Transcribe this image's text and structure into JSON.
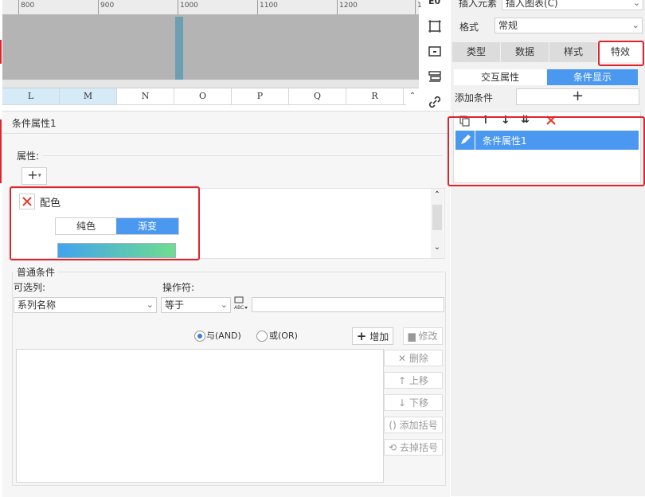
{
  "ruler": {
    "ticks": [
      "800",
      "900",
      "1000",
      "1100",
      "1200",
      "1"
    ]
  },
  "columns": [
    "L",
    "M",
    "N",
    "O",
    "P",
    "Q",
    "R"
  ],
  "condition_panel": {
    "title": "条件属性1",
    "property_section_label": "属性:",
    "add_button": "+",
    "property_item": {
      "name": "配色",
      "mode_options": [
        "纯色",
        "渐变"
      ],
      "selected_mode": "渐变",
      "gradient_colors": [
        "#42a3ee",
        "#6fdd8f"
      ]
    },
    "normal_condition": {
      "title": "普通条件",
      "column_label": "可选列:",
      "column_value": "系列名称",
      "operator_label": "操作符:",
      "operator_value": "等于",
      "value_input": "",
      "and_label": "与(AND)",
      "or_label": "或(OR)",
      "logic_selected": "and",
      "add_label": "增加",
      "modify_label": "修改",
      "delete_label": "删除",
      "up_label": "上移",
      "down_label": "下移",
      "add_bracket_label": "添加括号",
      "remove_bracket_label": "去掉括号"
    }
  },
  "right_panel": {
    "insert_element_label": "插入元素",
    "insert_element_value": "插入图表(C)",
    "format_label": "格式",
    "format_value": "常规",
    "tabs": [
      "类型",
      "数据",
      "样式",
      "特效"
    ],
    "active_tab": "特效",
    "subtabs": [
      "交互属性",
      "条件显示"
    ],
    "active_subtab": "条件显示",
    "add_condition_label": "添加条件",
    "add_condition_button": "+",
    "conditions": [
      "条件属性1"
    ]
  },
  "colors": {
    "accent": "#4a98f0",
    "highlight_border": "#e0242b",
    "danger": "#e43a2a"
  }
}
